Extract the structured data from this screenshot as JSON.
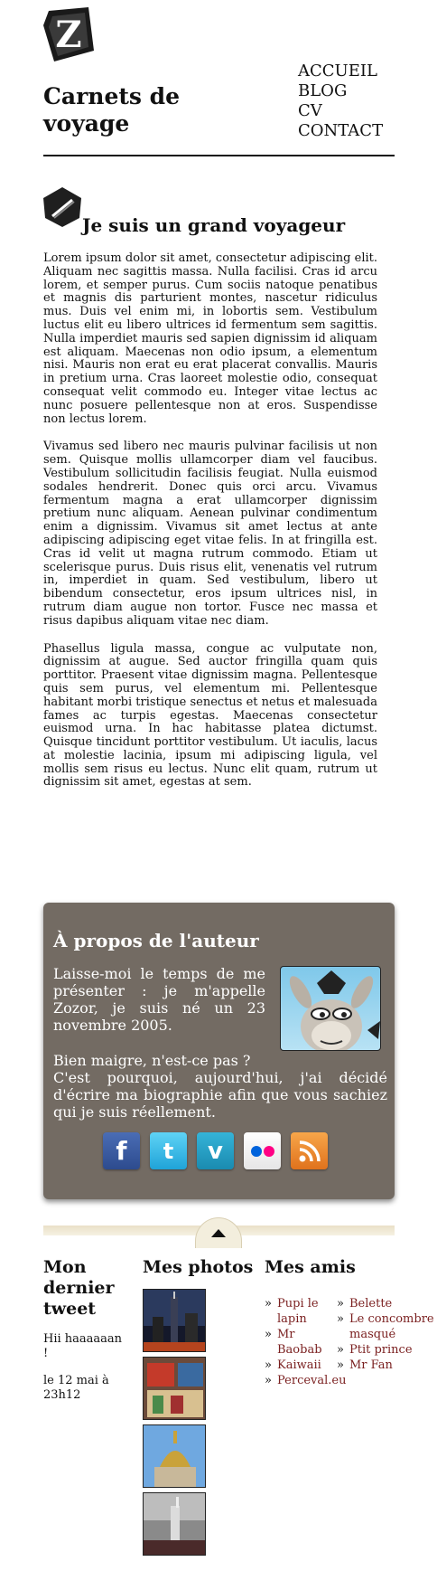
{
  "site": {
    "title": "Carnets de voyage",
    "logo": "zozor-logo-icon"
  },
  "nav": {
    "items": [
      "ACCUEIL",
      "BLOG",
      "CV",
      "CONTACT"
    ]
  },
  "article": {
    "icon": "pencil-badge-icon",
    "title": "Je suis un grand voyageur",
    "paragraphs": [
      "Lorem ipsum dolor sit amet, consectetur adipiscing elit. Aliquam nec sagittis massa. Nulla facilisi. Cras id arcu lorem, et semper purus. Cum sociis natoque penatibus et magnis dis parturient montes, nascetur ridiculus mus. Duis vel enim mi, in lobortis sem. Vestibulum luctus elit eu libero ultrices id fermentum sem sagittis. Nulla imperdiet mauris sed sapien dignissim id aliquam est aliquam. Maecenas non odio ipsum, a elementum nisi. Mauris non erat eu erat placerat convallis. Mauris in pretium urna. Cras laoreet molestie odio, consequat consequat velit commodo eu. Integer vitae lectus ac nunc posuere pellentesque non at eros. Suspendisse non lectus lorem.",
      "Vivamus sed libero nec mauris pulvinar facilisis ut non sem. Quisque mollis ullamcorper diam vel faucibus. Vestibulum sollicitudin facilisis feugiat. Nulla euismod sodales hendrerit. Donec quis orci arcu. Vivamus fermentum magna a erat ullamcorper dignissim pretium nunc aliquam. Aenean pulvinar condimentum enim a dignissim. Vivamus sit amet lectus at ante adipiscing adipiscing eget vitae felis. In at fringilla est. Cras id velit ut magna rutrum commodo. Etiam ut scelerisque purus. Duis risus elit, venenatis vel rutrum in, imperdiet in quam. Sed vestibulum, libero ut bibendum consectetur, eros ipsum ultrices nisl, in rutrum diam augue non tortor. Fusce nec massa et risus dapibus aliquam vitae nec diam.",
      "Phasellus ligula massa, congue ac vulputate non, dignissim at augue. Sed auctor fringilla quam quis porttitor. Praesent vitae dignissim magna. Pellentesque quis sem purus, vel elementum mi. Pellentesque habitant morbi tristique senectus et netus et malesuada fames ac turpis egestas. Maecenas consectetur euismod urna. In hac habitasse platea dictumst. Quisque tincidunt porttitor vestibulum. Ut iaculis, lacus at molestie lacinia, ipsum mi adipiscing ligula, vel mollis sem risus eu lectus. Nunc elit quam, rutrum ut dignissim sit amet, egestas at sem."
    ]
  },
  "author": {
    "title": "À propos de l'auteur",
    "paragraph1": "Laisse-moi le temps de me présenter : je m'appelle Zozor, je suis né un 23 novembre 2005.",
    "paragraph2_line1": "Bien maigre, n'est-ce pas ?",
    "paragraph2_line2": "C'est pourquoi, aujourd'hui, j'ai décidé d'écrire ma biographie afin que vous sachiez qui je suis réellement.",
    "avatar_icon": "zozor-donkey-avatar",
    "socials": [
      {
        "name": "facebook-icon",
        "glyph": "f"
      },
      {
        "name": "twitter-icon",
        "glyph": "t"
      },
      {
        "name": "vimeo-icon",
        "glyph": "v"
      },
      {
        "name": "flickr-icon",
        "glyph": ""
      },
      {
        "name": "rss-icon",
        "glyph": ""
      }
    ],
    "colors": {
      "box_bg": "#736b63"
    }
  },
  "footer": {
    "back_to_top_icon": "triangle-up-icon",
    "tweet": {
      "title": "Mon dernier tweet",
      "text": "Hii haaaaaan !",
      "date": "le 12 mai à 23h12"
    },
    "photos": {
      "title": "Mes photos",
      "items": [
        "city-skyline-photo",
        "street-shop-photo",
        "golden-dome-photo",
        "statue-liberty-photo"
      ]
    },
    "friends": {
      "title": "Mes amis",
      "column1": [
        "Pupi le lapin",
        "Mr Baobab",
        "Kaiwaii",
        "Perceval.eu"
      ],
      "column2": [
        "Belette",
        "Le concombre masqué",
        "Ptit prince",
        "Mr Fan"
      ],
      "link_color": "#7a1f1f"
    }
  }
}
